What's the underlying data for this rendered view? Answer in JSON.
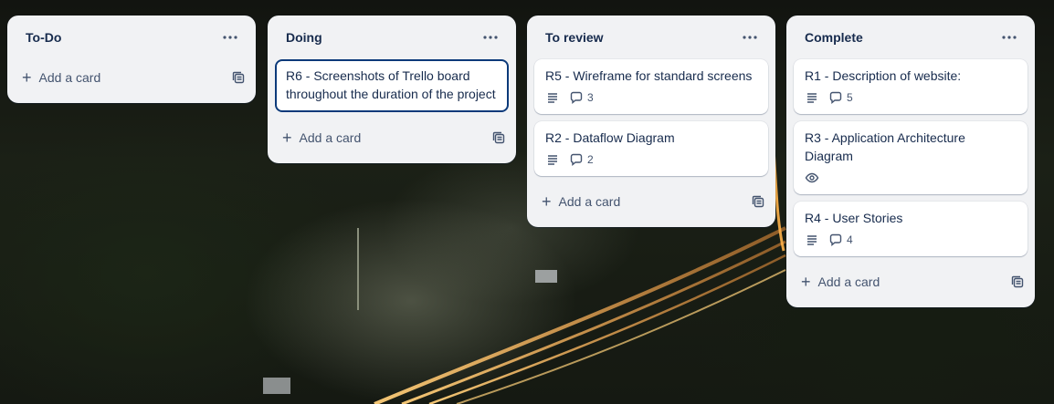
{
  "board": {
    "lists": [
      {
        "title": "To-Do",
        "add_card_label": "Add a card",
        "cards": []
      },
      {
        "title": "Doing",
        "add_card_label": "Add a card",
        "cards": [
          {
            "title": "R6 - Screenshots of Trello board throughout the duration of the project"
          }
        ]
      },
      {
        "title": "To review",
        "add_card_label": "Add a card",
        "cards": [
          {
            "title": "R5 - Wireframe for standard screens",
            "comments": "3"
          },
          {
            "title": "R2 - Dataflow Diagram",
            "comments": "2"
          }
        ]
      },
      {
        "title": "Complete",
        "add_card_label": "Add a card",
        "cards": [
          {
            "title": "R1 - Description of website:",
            "comments": "5"
          },
          {
            "title": "R3 - Application Architecture Diagram"
          },
          {
            "title": "R4 - User Stories",
            "comments": "4"
          }
        ]
      }
    ]
  },
  "icons": {
    "list_menu": "more-horizontal-icon",
    "add": "plus-icon",
    "template": "card-template-icon",
    "description": "description-icon",
    "comments": "comment-icon",
    "watch": "eye-icon"
  },
  "colors": {
    "list_bg": "#f1f2f4",
    "card_bg": "#ffffff",
    "text": "#172b4d",
    "subtle_text": "#44546f",
    "focus_border": "#0c3a7a"
  }
}
